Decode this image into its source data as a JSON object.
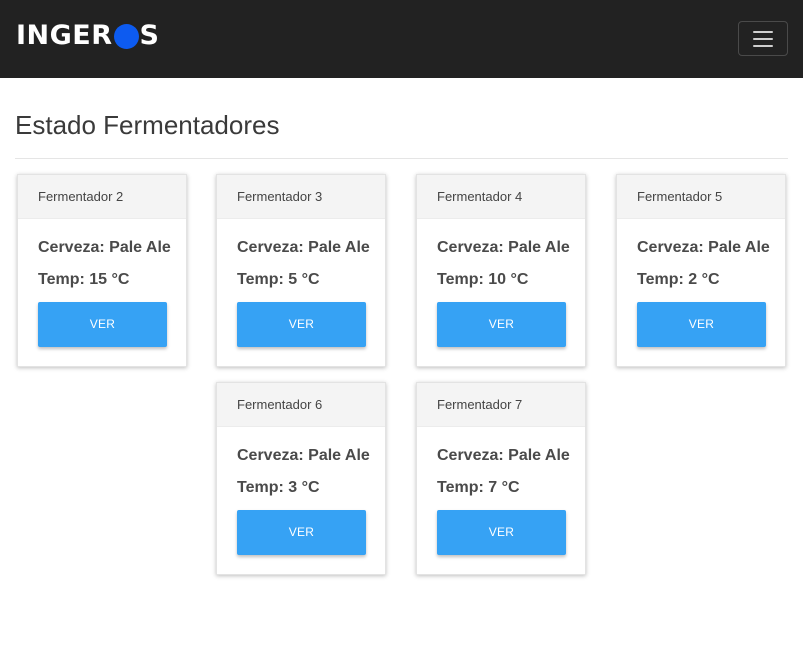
{
  "brand": {
    "text_before": "INGER",
    "text_after": "S",
    "accent_color": "#0d5bf0"
  },
  "navbar": {
    "toggle_icon": "hamburger-menu-icon",
    "background": "#222222"
  },
  "page": {
    "title": "Estado Fermentadores"
  },
  "fermenters": [
    {
      "name": "Fermentador 2",
      "beer": "Cerveza: Pale Ale",
      "temp": "Temp: 15 °C",
      "button": "VER"
    },
    {
      "name": "Fermentador 3",
      "beer": "Cerveza: Pale Ale",
      "temp": "Temp: 5 °C",
      "button": "VER"
    },
    {
      "name": "Fermentador 4",
      "beer": "Cerveza: Pale Ale",
      "temp": "Temp: 10 °C",
      "button": "VER"
    },
    {
      "name": "Fermentador 5",
      "beer": "Cerveza: Pale Ale",
      "temp": "Temp: 2 °C",
      "button": "VER"
    },
    {
      "name": "Fermentador 6",
      "beer": "Cerveza: Pale Ale",
      "temp": "Temp: 3 °C",
      "button": "VER"
    },
    {
      "name": "Fermentador 7",
      "beer": "Cerveza: Pale Ale",
      "temp": "Temp: 7 °C",
      "button": "VER"
    }
  ],
  "colors": {
    "button": "#36a2f4"
  }
}
